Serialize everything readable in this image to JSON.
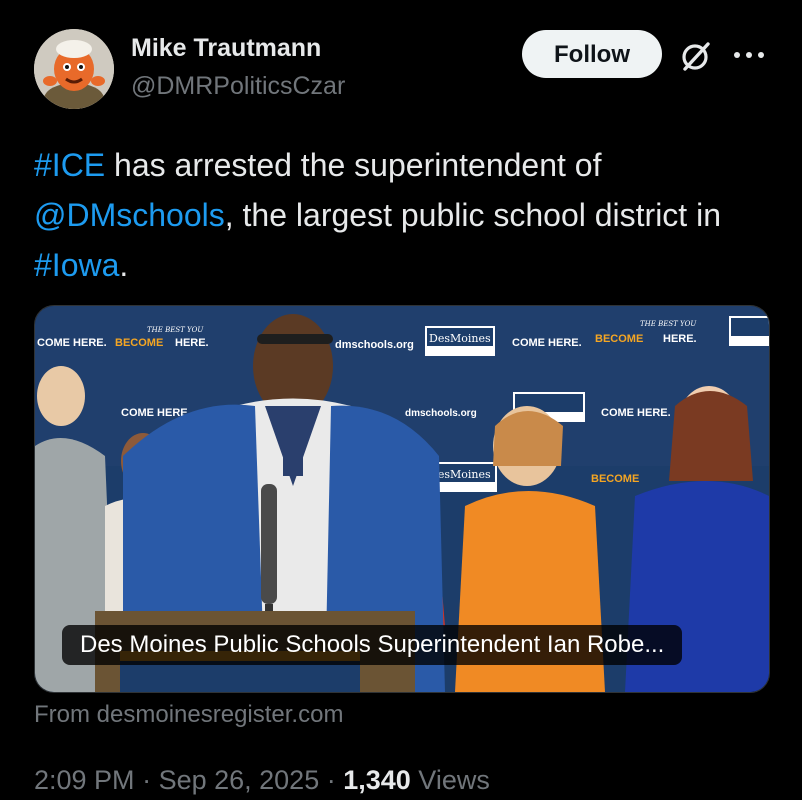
{
  "author": {
    "display_name": "Mike Trautmann",
    "handle": "@DMRPoliticsCzar"
  },
  "header": {
    "follow_label": "Follow",
    "icons": [
      "grok-icon",
      "more-icon"
    ]
  },
  "tweet": {
    "text_parts": {
      "p1": "#ICE",
      "p2": " has arrested the superintendent of ",
      "p3": "@DMschools",
      "p4": ", the largest public school district in ",
      "p5": "#Iowa",
      "p6": "."
    }
  },
  "card": {
    "caption": "Des Moines Public Schools Superintendent Ian Robe...",
    "source": "From desmoinesregister.com",
    "backdrop_texts": {
      "come_here": "COME HERE.",
      "become": "BECOME",
      "here": "HERE.",
      "best_you": "THE BEST YOU",
      "website": "dmschools.org",
      "brand": "DesMoines",
      "brand_sub": "PUBLIC SCHOOLS"
    }
  },
  "meta": {
    "time": "2:09 PM",
    "sep1": " · ",
    "date": "Sep 26, 2025",
    "sep2": " · ",
    "views_count": "1,340",
    "views_label": " Views"
  },
  "colors": {
    "background": "#000000",
    "text_primary": "#e7e9ea",
    "text_secondary": "#71767b",
    "link": "#1d9bf0",
    "follow_bg": "#eff3f4",
    "backdrop_blue": "#1c3d6a",
    "brand_orange": "#f5a623"
  }
}
